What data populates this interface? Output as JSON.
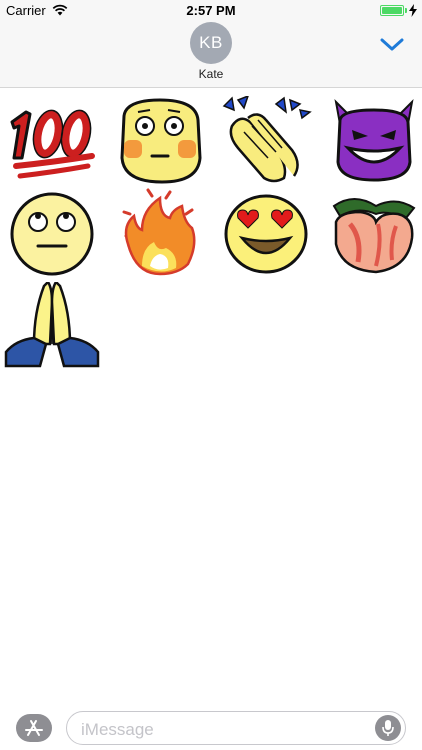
{
  "status_bar": {
    "carrier": "Carrier",
    "time": "2:57 PM",
    "battery_level": 1.0,
    "battery_color": "#4cd964",
    "icons": [
      "wifi-icon",
      "battery-icon",
      "charging-bolt-icon"
    ]
  },
  "header": {
    "avatar_initials": "KB",
    "contact_name": "Kate",
    "avatar_color": "#a3a9b3",
    "expand_icon": "chevron-down-icon",
    "accent_color": "#1f7bd8"
  },
  "stickers": [
    {
      "name": "hundred-points-sticker"
    },
    {
      "name": "flushed-face-sticker"
    },
    {
      "name": "clapping-hands-sticker"
    },
    {
      "name": "smiling-devil-sticker"
    },
    {
      "name": "eye-roll-face-sticker"
    },
    {
      "name": "fire-sticker"
    },
    {
      "name": "heart-eyes-face-sticker"
    },
    {
      "name": "peach-sticker"
    },
    {
      "name": "praying-hands-sticker"
    }
  ],
  "compose": {
    "placeholder": "iMessage",
    "left_icon": "app-store-icon",
    "right_icon": "microphone-icon"
  }
}
